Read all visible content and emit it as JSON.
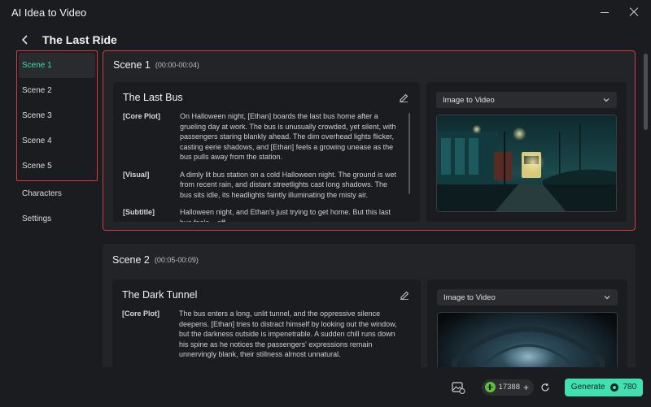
{
  "window": {
    "title": "AI Idea to Video"
  },
  "header": {
    "title": "The Last Ride"
  },
  "sidebar": {
    "scenes": [
      {
        "label": "Scene 1",
        "active": true
      },
      {
        "label": "Scene 2"
      },
      {
        "label": "Scene 3"
      },
      {
        "label": "Scene 4"
      },
      {
        "label": "Scene 5"
      }
    ],
    "extras": [
      {
        "label": "Characters"
      },
      {
        "label": "Settings"
      }
    ]
  },
  "scenes": [
    {
      "name": "Scene 1",
      "time": "(00:00-00:04)",
      "title": "The Last Bus",
      "rows": [
        {
          "label": "[Core Plot]",
          "text": "On Halloween night, [Ethan] boards the last bus home after a grueling day at work. The bus is unusually crowded, yet silent, with passengers staring blankly ahead. The dim overhead lights flicker, casting eerie shadows, and [Ethan] feels a growing unease as the bus pulls away from the station."
        },
        {
          "label": "[Visual]",
          "text": "A dimly lit bus station on a cold Halloween night. The ground is wet from recent rain, and distant streetlights cast long shadows. The bus sits idle, its headlights faintly illuminating the misty air."
        },
        {
          "label": "[Subtitle]",
          "text": "Halloween night, and Ethan's just trying to get home. But this last bus feels... off."
        }
      ],
      "mode": "Image to Video"
    },
    {
      "name": "Scene 2",
      "time": "(00:05-00:09)",
      "title": "The Dark Tunnel",
      "rows": [
        {
          "label": "[Core Plot]",
          "text": "The bus enters a long, unlit tunnel, and the oppressive silence deepens. [Ethan] tries to distract himself by looking out the window, but the darkness outside is impenetrable. A sudden chill runs down his spine as he notices the passengers' expressions remain unnervingly blank, their stillness almost unnatural."
        }
      ],
      "mode": "Image to Video"
    }
  ],
  "footer": {
    "credits": "17388",
    "generate_label": "Generate",
    "generate_cost": "780"
  },
  "colors": {
    "accent": "#40e0b0",
    "highlight": "#d23b41",
    "background": "#1b1c1f"
  }
}
